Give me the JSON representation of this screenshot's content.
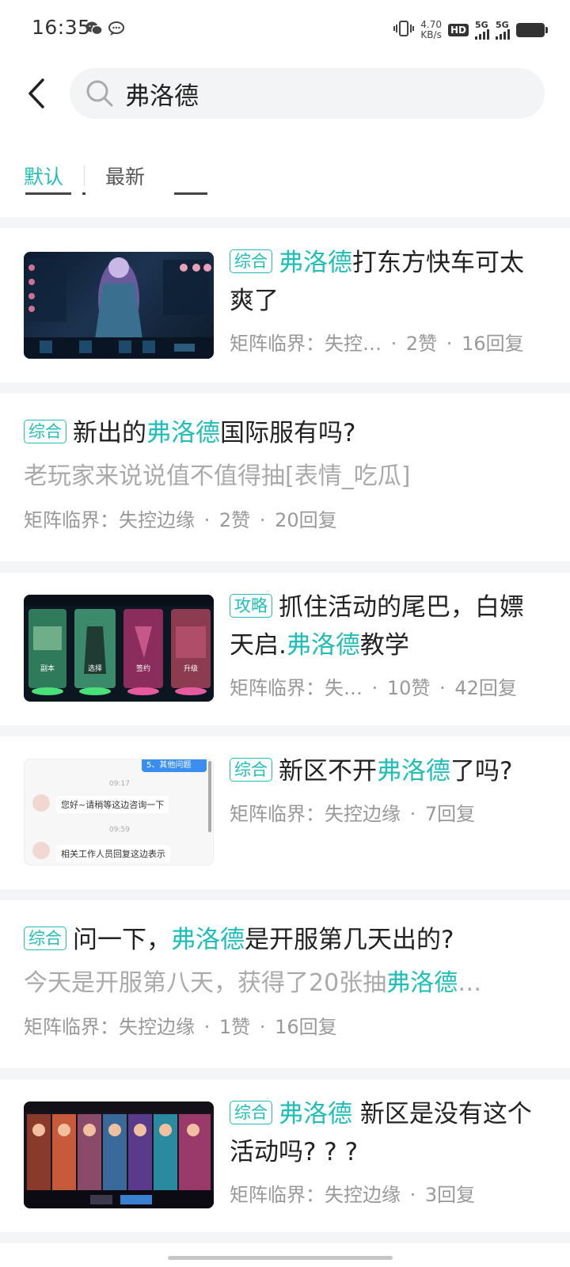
{
  "status": {
    "time": "16:35",
    "speed_value": "4.70",
    "speed_unit": "KB/s",
    "hd_label": "HD",
    "sim1_label": "5G",
    "sim2_label": "5G",
    "icons": [
      "wechat-icon",
      "chat-bubble-icon",
      "vibrate-icon",
      "signal-icon",
      "battery-icon"
    ]
  },
  "search": {
    "query": "弗洛德",
    "placeholder": ""
  },
  "tabs": [
    {
      "label": "默认",
      "active": true
    },
    {
      "label": "最新",
      "active": false
    }
  ],
  "accent_color": "#1fbfb8",
  "posts": [
    {
      "tag": "综合",
      "title_before": "",
      "title_highlight": "弗洛德",
      "title_after": "打东方快车可太爽了",
      "meta_game": "矩阵临界：失控…",
      "meta_likes": "2赞",
      "meta_replies": "16回复"
    },
    {
      "tag": "综合",
      "title_before": "新出的",
      "title_highlight": "弗洛德",
      "title_after": "国际服有吗?",
      "excerpt": "老玩家来说说值不值得抽[表情_吃瓜]",
      "meta_game": "矩阵临界：失控边缘",
      "meta_likes": "2赞",
      "meta_replies": "20回复"
    },
    {
      "tag": "攻略",
      "title_before": "抓住活动的尾巴，白嫖天启.",
      "title_highlight": "弗洛德",
      "title_after": "教学",
      "meta_game": "矩阵临界：失…",
      "meta_likes": "10赞",
      "meta_replies": "42回复",
      "thumb_labels": [
        "副本",
        "选择",
        "签约",
        "升级"
      ]
    },
    {
      "tag": "综合",
      "title_before": "新区不开",
      "title_highlight": "弗洛德",
      "title_after": "了吗?",
      "meta_game": "矩阵临界：失控边缘",
      "meta_replies": "7回复",
      "thumb_chat": {
        "header": "5、其他问题",
        "time1": "09:17",
        "msg1": "您好~请稍等这边咨询一下",
        "time2": "09:59",
        "msg2": "相关工作人员回复这边表示"
      }
    },
    {
      "tag": "综合",
      "title_before": "问一下，",
      "title_highlight": "弗洛德",
      "title_after": "是开服第几天出的?",
      "excerpt_before": "今天是开服第八天，获得了20张抽",
      "excerpt_highlight": "弗洛德",
      "excerpt_after": "…",
      "meta_game": "矩阵临界：失控边缘",
      "meta_likes": "1赞",
      "meta_replies": "16回复"
    },
    {
      "tag": "综合",
      "title_before": "",
      "title_highlight": "弗洛德",
      "title_after": " 新区是没有这个活动吗? ? ?",
      "meta_game": "矩阵临界：失控边缘",
      "meta_replies": "3回复"
    }
  ]
}
